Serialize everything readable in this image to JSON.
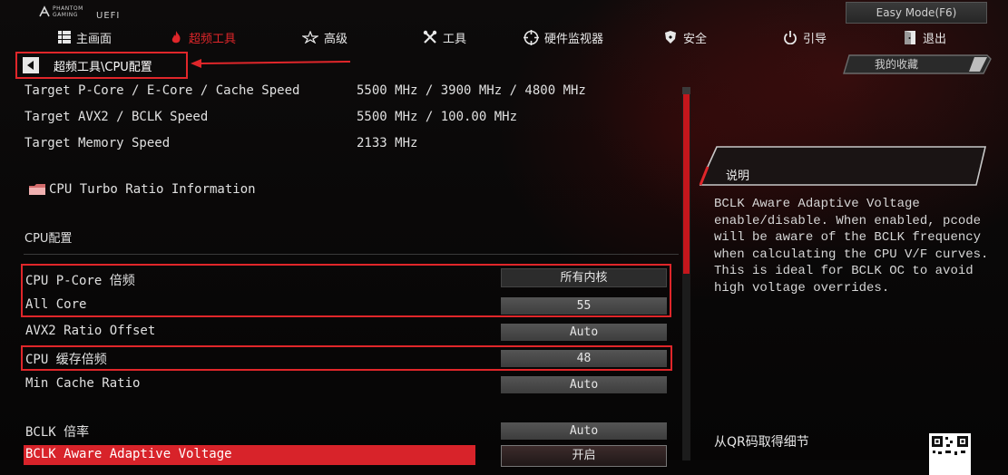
{
  "header": {
    "brand_line1": "PHANTOM",
    "brand_line2": "GAMING",
    "uefi": "UEFI",
    "easy_mode": "Easy Mode(F6)"
  },
  "nav": [
    {
      "label": "主画面",
      "icon": "grid-icon",
      "active": false
    },
    {
      "label": "超频工具",
      "icon": "flame-icon",
      "active": true
    },
    {
      "label": "高级",
      "icon": "star-icon",
      "active": false
    },
    {
      "label": "工具",
      "icon": "tools-icon",
      "active": false
    },
    {
      "label": "硬件监视器",
      "icon": "crosshair-icon",
      "active": false
    },
    {
      "label": "安全",
      "icon": "shield-icon",
      "active": false
    },
    {
      "label": "引导",
      "icon": "power-icon",
      "active": false
    },
    {
      "label": "退出",
      "icon": "exit-icon",
      "active": false
    }
  ],
  "breadcrumb": "超频工具\\CPU配置",
  "favorites": "我的收藏",
  "info": [
    {
      "label": "Target P-Core / E-Core / Cache Speed",
      "value": "5500 MHz / 3900 MHz / 4800 MHz"
    },
    {
      "label": "Target AVX2 / BCLK Speed",
      "value": "5500 MHz / 100.00 MHz"
    },
    {
      "label": "Target Memory Speed",
      "value": "2133 MHz"
    }
  ],
  "turbo_ratio": "CPU Turbo Ratio Information",
  "section_title": "CPU配置",
  "settings": [
    {
      "label": "CPU P-Core 倍频",
      "value": "所有内核"
    },
    {
      "label": " All Core",
      "value": "55"
    },
    {
      "label": "AVX2 Ratio Offset",
      "value": "Auto"
    },
    {
      "label": "CPU  缓存倍频",
      "value": "48"
    },
    {
      "label": "Min Cache  Ratio",
      "value": "Auto"
    },
    {
      "label": "BCLK 倍率",
      "value": "Auto"
    },
    {
      "label": "BCLK Aware Adaptive Voltage",
      "value": "开启"
    }
  ],
  "description": {
    "title": "说明",
    "body": "BCLK Aware Adaptive Voltage\nenable/disable. When enabled, pcode\nwill be aware of the BCLK frequency\nwhen calculating the CPU V/F curves.\nThis is ideal for BCLK OC to avoid\nhigh voltage overrides."
  },
  "qr_label": "从QR码取得细节",
  "colors": {
    "accent": "#e0262a",
    "highlight": "#d8232a",
    "background": "#070606"
  }
}
